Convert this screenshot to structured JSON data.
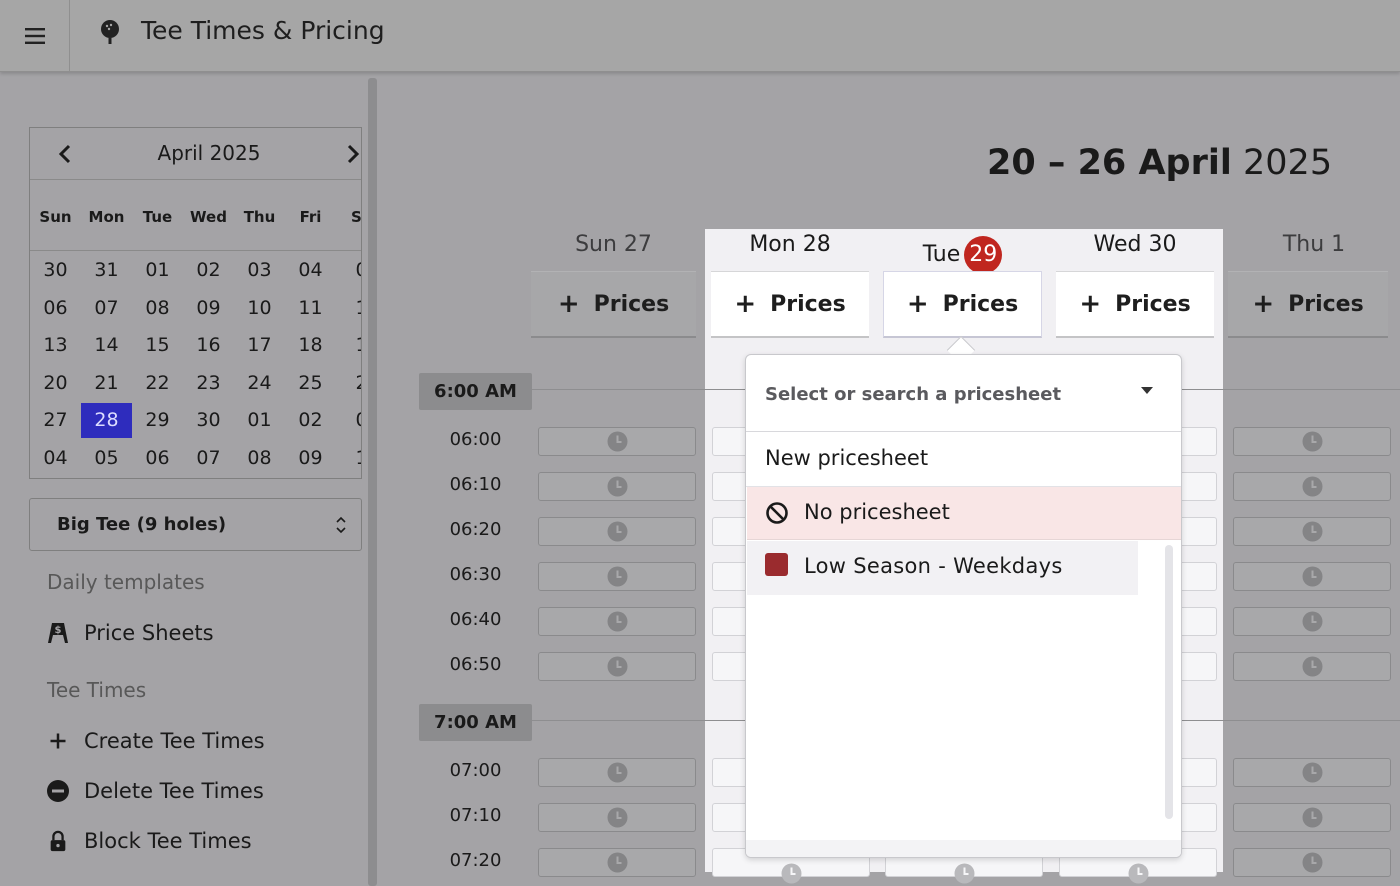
{
  "header": {
    "title": "Tee Times & Pricing"
  },
  "calendar": {
    "month_label": "April 2025",
    "weekdays": [
      "Sun",
      "Mon",
      "Tue",
      "Wed",
      "Thu",
      "Fri",
      "Sa"
    ],
    "weeks": [
      [
        "30",
        "31",
        "01",
        "02",
        "03",
        "04",
        "0"
      ],
      [
        "06",
        "07",
        "08",
        "09",
        "10",
        "11",
        "1"
      ],
      [
        "13",
        "14",
        "15",
        "16",
        "17",
        "18",
        "1"
      ],
      [
        "20",
        "21",
        "22",
        "23",
        "24",
        "25",
        "2"
      ],
      [
        "27",
        "28",
        "29",
        "30",
        "01",
        "02",
        "0"
      ],
      [
        "04",
        "05",
        "06",
        "07",
        "08",
        "09",
        "1"
      ]
    ],
    "selected": "28"
  },
  "course_select": {
    "value": "Big Tee (9 holes)"
  },
  "sidebar": {
    "daily_templates_heading": "Daily templates",
    "price_sheets_label": "Price Sheets",
    "tee_times_heading": "Tee Times",
    "create_label": "Create Tee Times",
    "delete_label": "Delete Tee Times",
    "block_label": "Block Tee Times"
  },
  "main": {
    "range_bold": "20 – 26 April",
    "range_year": "2025",
    "days": [
      {
        "label": "Sun 27"
      },
      {
        "label": "Mon 28"
      },
      {
        "label": "Tue",
        "num": "29"
      },
      {
        "label": "Wed 30"
      },
      {
        "label": "Thu 1"
      }
    ],
    "prices_button_label": "Prices",
    "hours": [
      "6:00 AM",
      "7:00 AM"
    ],
    "times": [
      "06:00",
      "06:10",
      "06:20",
      "06:30",
      "06:40",
      "06:50",
      "07:00",
      "07:10",
      "07:20"
    ]
  },
  "pricesheet_dropdown": {
    "placeholder": "Select or search a pricesheet",
    "new_option": "New pricesheet",
    "none_option": "No pricesheet",
    "items": [
      {
        "label": "Low Season - Weekdays",
        "color": "#9a2b2e"
      }
    ]
  },
  "colors": {
    "selected_day": "#2e2cbd",
    "today_badge": "#c0261f",
    "no_pricesheet_bg": "#f9e6e6"
  }
}
